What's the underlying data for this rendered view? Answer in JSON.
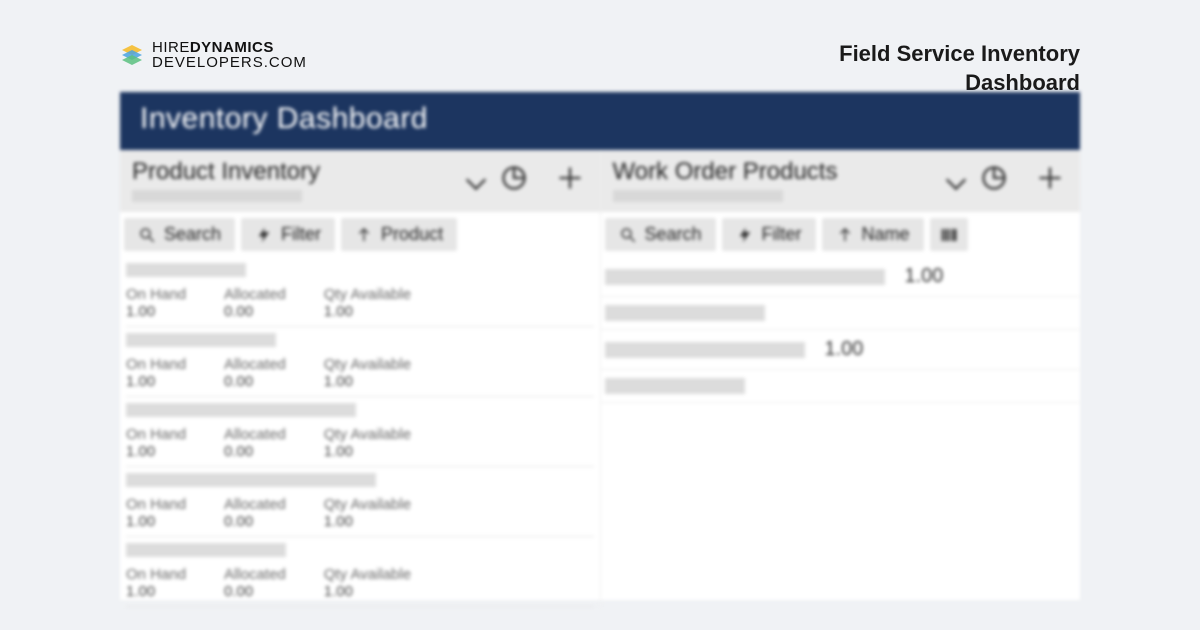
{
  "logo": {
    "line1_a": "HIRE",
    "line1_b": "DYNAMICS",
    "line2": "DEVELOPERS.COM"
  },
  "hero_title": "Field Service Inventory Dashboard",
  "app_title": "Inventory Dashboard",
  "panels": {
    "inventory": {
      "title": "Product Inventory",
      "tools": {
        "search": "Search",
        "filter": "Filter",
        "sort": "Product"
      },
      "labels": {
        "on_hand": "On Hand",
        "allocated": "Allocated",
        "qty_avail": "Qty Available"
      },
      "rows": [
        {
          "on_hand": "1.00",
          "allocated": "0.00",
          "qty_avail": "1.00"
        },
        {
          "on_hand": "1.00",
          "allocated": "0.00",
          "qty_avail": "1.00"
        },
        {
          "on_hand": "1.00",
          "allocated": "0.00",
          "qty_avail": "1.00"
        },
        {
          "on_hand": "1.00",
          "allocated": "0.00",
          "qty_avail": "1.00"
        },
        {
          "on_hand": "1.00",
          "allocated": "0.00",
          "qty_avail": "1.00"
        }
      ]
    },
    "work_orders": {
      "title": "Work Order Products",
      "tools": {
        "search": "Search",
        "filter": "Filter",
        "sort": "Name"
      },
      "rows": [
        {
          "qty": "1.00"
        },
        {
          "qty": ""
        },
        {
          "qty": "1.00"
        },
        {
          "qty": ""
        }
      ]
    }
  }
}
